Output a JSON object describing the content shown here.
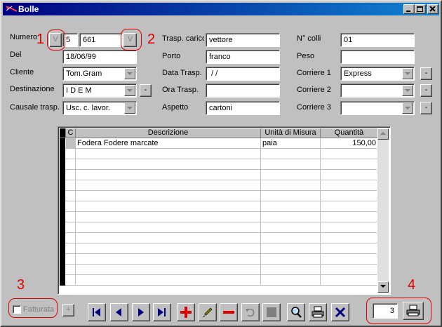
{
  "window": {
    "title": "Bolle"
  },
  "form": {
    "numero_label": "Numero",
    "numero_series": "5",
    "numero_value": "661",
    "v_button_label": "V",
    "del_label": "Del",
    "del_value": "18/06/99",
    "cliente_label": "Cliente",
    "cliente_value": "Tom.Gram",
    "destinazione_label": "Destinazione",
    "destinazione_value": "I D E M",
    "causale_label": "Causale trasp.",
    "causale_value": "Usc. c. lavor.",
    "trasp_carico_label": "Trasp. carico",
    "trasp_carico_value": "vettore",
    "porto_label": "Porto",
    "porto_value": "franco",
    "data_trasp_label": "Data Trasp.",
    "data_trasp_value": " / /",
    "ora_trasp_label": "Ora Trasp.",
    "ora_trasp_value": "",
    "aspetto_label": "Aspetto",
    "aspetto_value": "cartoni",
    "n_colli_label": "N° colli",
    "n_colli_value": "01",
    "peso_label": "Peso",
    "peso_value": "",
    "corriere1_label": "Corriere 1",
    "corriere1_value": "Express",
    "corriere2_label": "Corriere 2",
    "corriere2_value": "",
    "corriere3_label": "Corriere 3",
    "corriere3_value": "",
    "small_button_label": "-"
  },
  "grid": {
    "columns": [
      "C",
      "Descrizione",
      "Unità di Misura",
      "Quantità"
    ],
    "rows": [
      {
        "descrizione": "Fodera Fodere marcate",
        "unita": "paia",
        "quantita": "150,00"
      }
    ]
  },
  "bottom": {
    "fatturata_label": "Fatturata",
    "plus_label": "+",
    "copies_value": "3"
  },
  "annotations": [
    "1",
    "2",
    "3",
    "4"
  ],
  "colors": {
    "title_bar": "#000080",
    "nav_blue": "#000080",
    "add_red": "#e00000",
    "annotation_red": "#e00000"
  }
}
